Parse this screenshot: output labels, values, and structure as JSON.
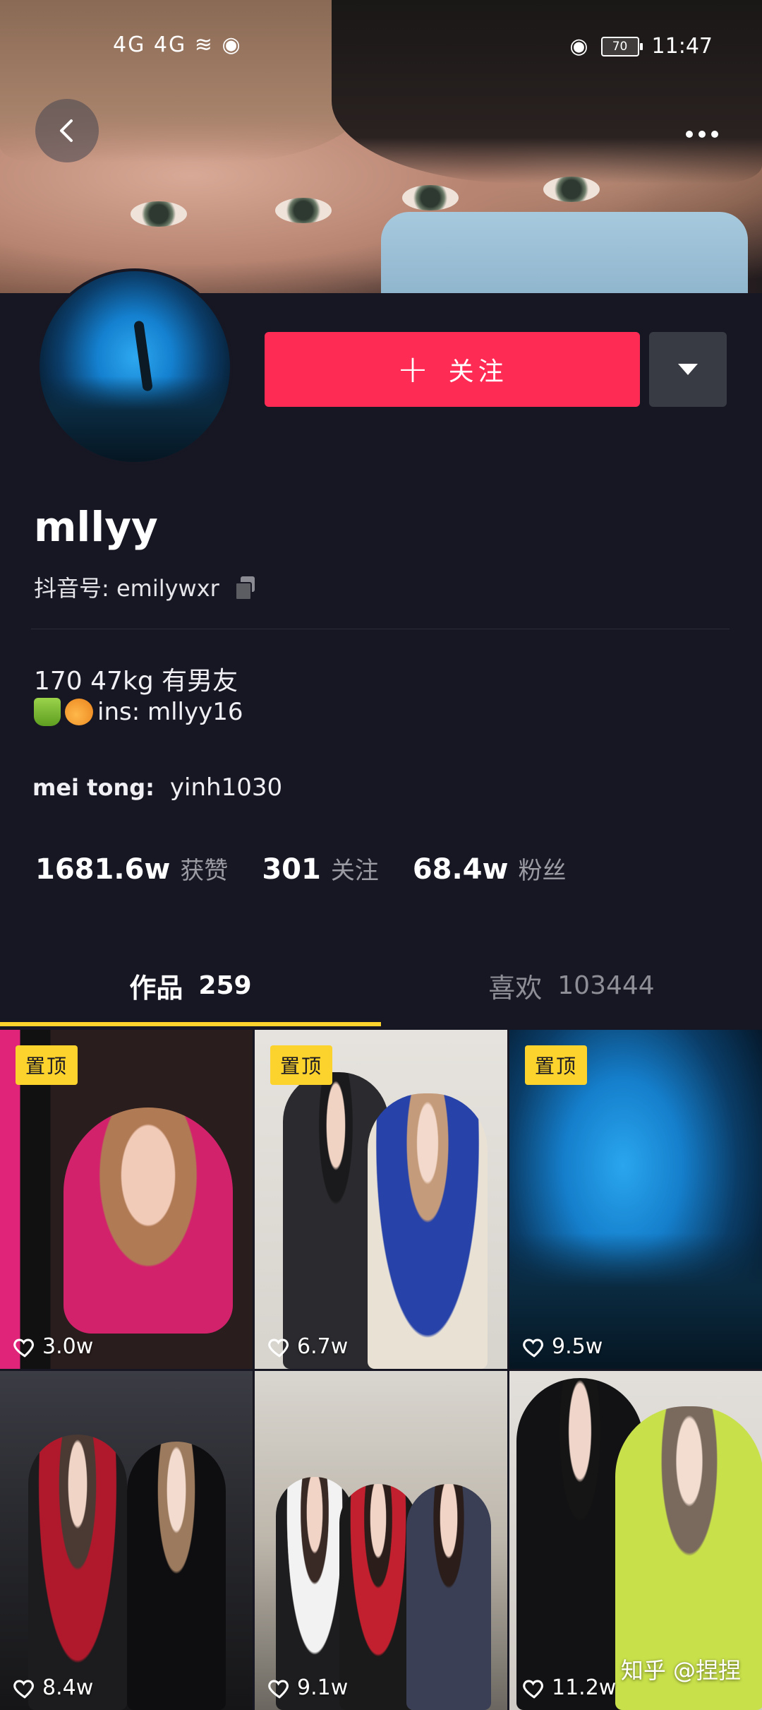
{
  "status_bar": {
    "signals": "4G 4G",
    "time": "11:47",
    "battery": "70"
  },
  "profile": {
    "name": "mllyy",
    "douyin_id": "抖音号: emilywxr",
    "follow_label": "关注",
    "bio_line1": "170 47kg 有男友",
    "bio_ins": "ins: mllyy16",
    "bio_mei_key": "mei tong:",
    "bio_mei_value": "yinh1030"
  },
  "stats": [
    {
      "value": "1681.6w",
      "label": "获赞"
    },
    {
      "value": "301",
      "label": "关注"
    },
    {
      "value": "68.4w",
      "label": "粉丝"
    }
  ],
  "tabs": [
    {
      "label": "作品",
      "count": "259",
      "active": true
    },
    {
      "label": "喜欢",
      "count": "103444",
      "active": false
    }
  ],
  "videos": [
    {
      "pinned": "置顶",
      "likes": "3.0w"
    },
    {
      "pinned": "置顶",
      "likes": "6.7w"
    },
    {
      "pinned": "置顶",
      "likes": "9.5w"
    },
    {
      "pinned": "",
      "likes": "8.4w"
    },
    {
      "pinned": "",
      "likes": "9.1w"
    },
    {
      "pinned": "",
      "likes": "11.2w"
    }
  ],
  "watermark": "知乎 @捏捏",
  "colors": {
    "background": "#161723",
    "follow_button": "#fe2c55",
    "accent_yellow": "#fcd22c"
  }
}
